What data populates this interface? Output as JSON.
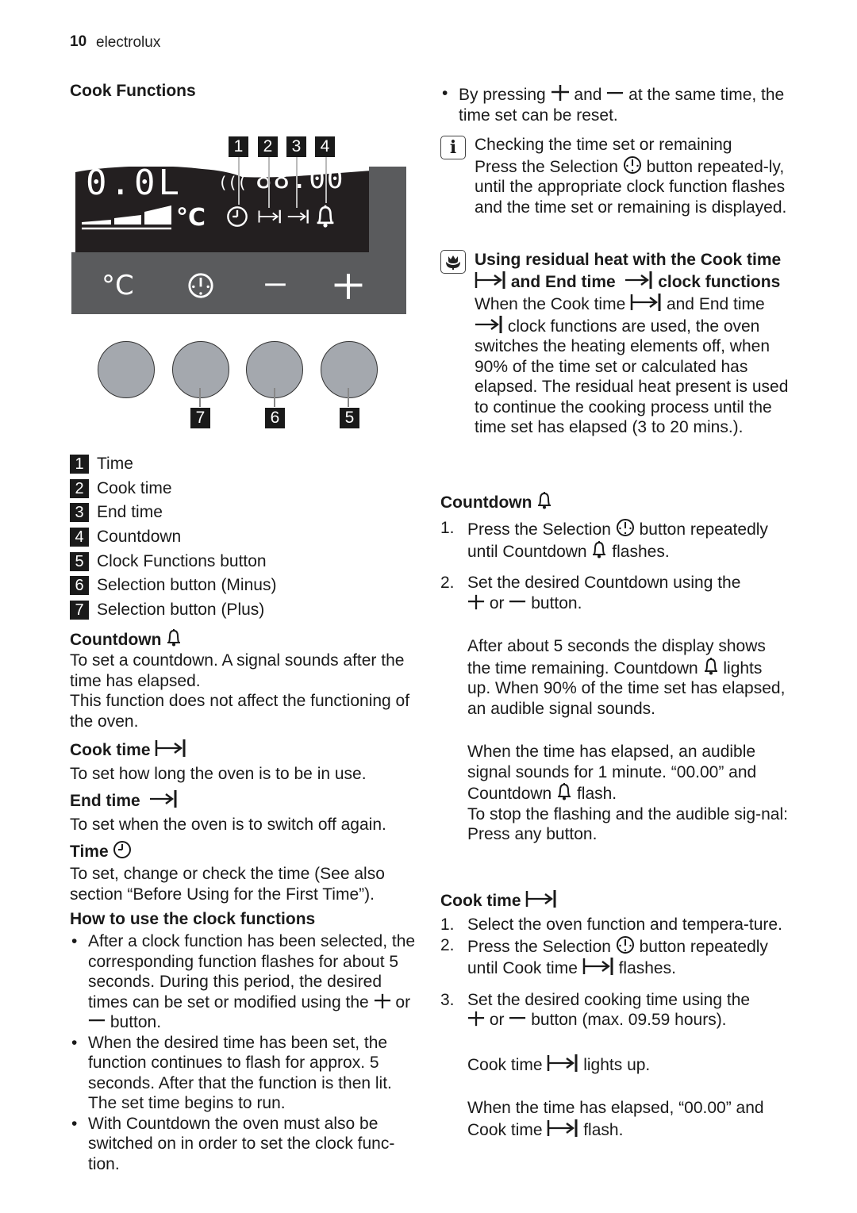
{
  "header": {
    "page_number": "10",
    "brand": "electrolux"
  },
  "left": {
    "title": "Cook Functions",
    "diagram": {
      "display_left_digits": "0.0L",
      "display_right_digits": "88.00",
      "display_unit": "°C",
      "panel_symbols": [
        "°C",
        "clock-selection",
        "minus",
        "plus"
      ],
      "callouts_top": [
        "1",
        "2",
        "3",
        "4"
      ],
      "callouts_bottom": [
        "7",
        "6",
        "5"
      ],
      "display_icons": [
        "clock-icon",
        "cook-time-icon",
        "end-time-icon",
        "bell-icon"
      ],
      "knob_count": 4
    },
    "legend": [
      {
        "num": "1",
        "label": "Time"
      },
      {
        "num": "2",
        "label": "Cook time"
      },
      {
        "num": "3",
        "label": "End time"
      },
      {
        "num": "4",
        "label": "Countdown"
      },
      {
        "num": "5",
        "label": "Clock Functions button"
      },
      {
        "num": "6",
        "label": "Selection button (Minus)"
      },
      {
        "num": "7",
        "label": "Selection button (Plus)"
      }
    ],
    "countdown": {
      "heading": "Countdown",
      "p1": "To set a countdown. A signal sounds after the time has elapsed.",
      "p2": "This function does not affect the functioning of the oven."
    },
    "cook_time": {
      "heading": "Cook time",
      "text": "To set how long the oven is to be in use."
    },
    "end_time": {
      "heading": "End time",
      "text": "To set when the oven is to switch off again."
    },
    "time": {
      "heading": "Time",
      "text": "To set, change or check the time (See also section “Before Using for the First Time”)."
    },
    "how_to": {
      "heading": "How to use the clock functions",
      "b1_a": "After a clock function has been selected, the corresponding function flashes for about 5 seconds. During this period, the desired times can be set or modified using the",
      "b1_or": "or",
      "b1_b": "button.",
      "b2": "When the desired time has been set, the function continues to flash for approx. 5 seconds. After that the function is then lit. The set time begins to run.",
      "b3": "With Countdown the oven must also be switched on in order to set the clock func-tion."
    }
  },
  "right": {
    "reset_bullet": {
      "a": "By pressing",
      "and": "and",
      "b": "at the same time, the time set can be reset."
    },
    "info": {
      "title": "Checking the time set or remaining",
      "a": "Press the Selection",
      "b": "button repeated-ly, until the appropriate clock function flashes and the time set or remaining is displayed."
    },
    "residual": {
      "h_a": "Using residual heat with the Cook time",
      "h_b": "and End time",
      "h_c": "clock functions",
      "t_a": "When the Cook time",
      "t_b": "and End time",
      "t_c": "clock functions are used, the oven switches the heating elements off, when 90% of the time set or calculated has elapsed. The residual heat present is used to continue the cooking process until the time set has elapsed (3 to 20 mins.)."
    },
    "countdown": {
      "heading": "Countdown",
      "s1_num": "1.",
      "s1_a": "Press the Selection",
      "s1_b": "button repeatedly until Countdown",
      "s1_c": "flashes.",
      "s2_num": "2.",
      "s2_a": "Set the desired Countdown using the",
      "s2_or": "or",
      "s2_b": "button.",
      "p1_a": "After about 5 seconds the display shows the time remaining. Countdown",
      "p1_b": "lights up. When 90% of the time set has elapsed, an audible signal sounds.",
      "p2_a": "When the time has elapsed, an audible signal sounds for 1 minute. “00.00” and Countdown",
      "p2_b": "flash.",
      "p3": "To stop the flashing and the audible sig-nal:",
      "p4": "Press any button."
    },
    "cook_time": {
      "heading": "Cook time",
      "s1_num": "1.",
      "s1": "Select the oven function and tempera-ture.",
      "s2_num": "2.",
      "s2_a": "Press the Selection",
      "s2_b": "button repeatedly until Cook time",
      "s2_c": "flashes.",
      "s3_num": "3.",
      "s3_a": "Set the desired cooking time using the",
      "s3_or": "or",
      "s3_b": "button (max. 09.59 hours).",
      "p1_a": "Cook time",
      "p1_b": "lights up.",
      "p2_a": "When the time has elapsed, “00.00” and Cook time",
      "p2_b": "flash."
    }
  }
}
